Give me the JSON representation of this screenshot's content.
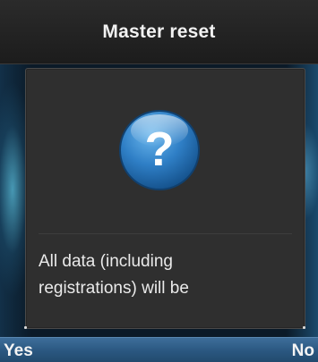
{
  "header": {
    "title": "Master reset"
  },
  "dialog": {
    "icon": "question-icon",
    "icon_glyph": "?",
    "message_lines": [
      "All data (including",
      "registrations) will be"
    ]
  },
  "softkeys": {
    "left_label": "Yes",
    "right_label": "No"
  },
  "colors": {
    "title_bar": "#222222",
    "dialog_bg": "#2f2f2f",
    "icon_blue": "#2f7fc6",
    "softkey_bar": "#2a5780",
    "text": "#eaeaea"
  }
}
